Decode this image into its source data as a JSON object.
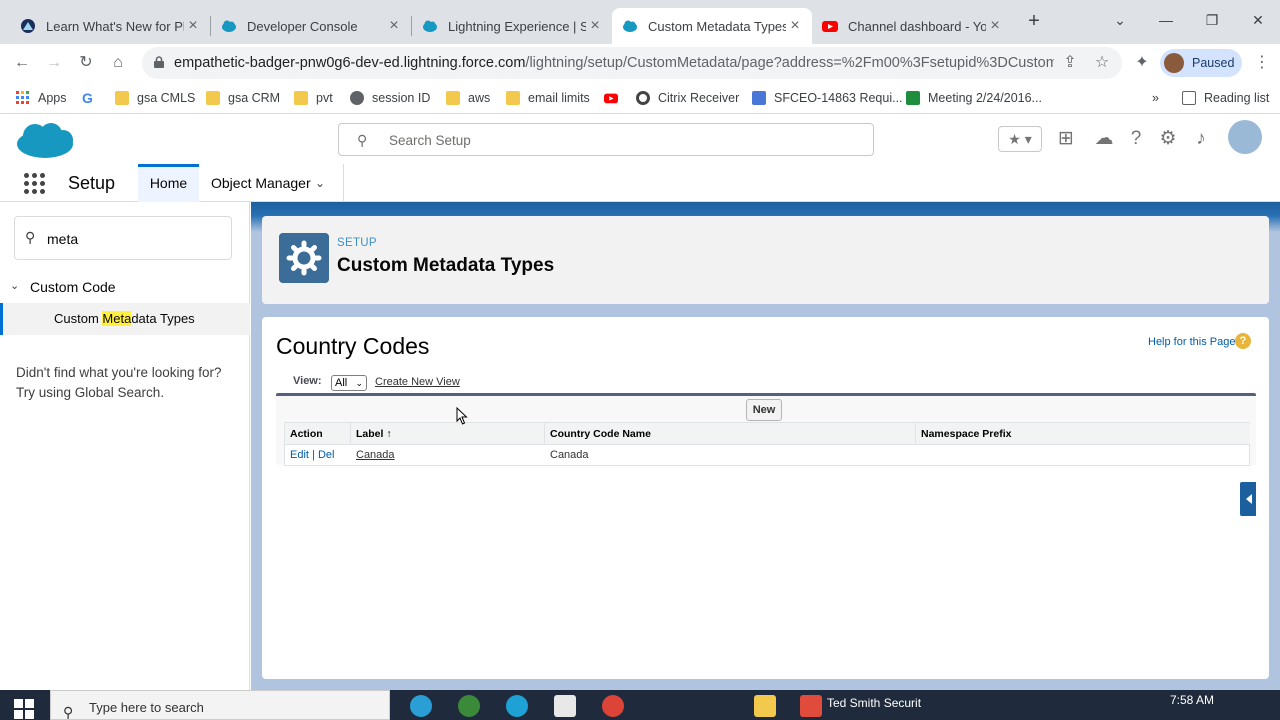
{
  "browser": {
    "tabs": [
      {
        "title": "Learn What's New for Platf",
        "icon": "trailhead-icon",
        "color": "#1b2f5b"
      },
      {
        "title": "Developer Console",
        "icon": "salesforce-cloud-icon",
        "color": "#1798c1"
      },
      {
        "title": "Lightning Experience | Sal",
        "icon": "salesforce-cloud-icon",
        "color": "#1798c1"
      },
      {
        "title": "Custom Metadata Types |",
        "icon": "salesforce-cloud-icon",
        "color": "#1798c1"
      },
      {
        "title": "Channel dashboard - You",
        "icon": "youtube-icon",
        "color": "#ff0000"
      }
    ],
    "active_tab_index": 3,
    "url_domain": "empathetic-badger-pnw0g6-dev-ed.lightning.force.com",
    "url_path": "/lightning/setup/CustomMetadata/page?address=%2Fm00%3Fsetupid%3DCustom...",
    "profile_label": "Paused",
    "bookmarks": [
      {
        "label": "Apps",
        "icon": "apps-grid-icon"
      },
      {
        "label": "",
        "icon": "google-icon"
      },
      {
        "label": "gsa CMLS",
        "icon": "folder-icon"
      },
      {
        "label": "gsa CRM",
        "icon": "folder-icon"
      },
      {
        "label": "pvt",
        "icon": "folder-icon"
      },
      {
        "label": "session ID",
        "icon": "globe-icon"
      },
      {
        "label": "aws",
        "icon": "folder-icon"
      },
      {
        "label": "email limits",
        "icon": "folder-icon"
      },
      {
        "label": "",
        "icon": "youtube-icon"
      },
      {
        "label": "Citrix Receiver",
        "icon": "citrix-icon"
      },
      {
        "label": "SFCEO-14863 Requi...",
        "icon": "doc-icon"
      },
      {
        "label": "Meeting 2/24/2016...",
        "icon": "sheets-icon"
      }
    ],
    "bookmarks_overflow": "»",
    "reading_list": "Reading list"
  },
  "sf": {
    "search_placeholder": "Search Setup",
    "app_name": "Setup",
    "nav_tabs": {
      "home": "Home",
      "object_manager": "Object Manager"
    },
    "sidebar": {
      "quick_find_value": "meta",
      "section": "Custom Code",
      "item_pre": "Custom ",
      "item_match": "Meta",
      "item_post": "data Types",
      "not_found_1": "Didn't find what you're looking for?",
      "not_found_2": "Try using Global Search."
    },
    "page_header": {
      "eyebrow": "SETUP",
      "title": "Custom Metadata Types"
    },
    "list": {
      "title": "Country Codes",
      "help": "Help for this Page",
      "help_glyph": "?",
      "view_label": "View:",
      "view_value": "All",
      "create_view": "Create New View",
      "new_button": "New",
      "columns": [
        "Action",
        "Label ↑",
        "Country Code Name",
        "Namespace Prefix"
      ],
      "rows": [
        {
          "edit": "Edit",
          "sep": "|",
          "del": "Del",
          "label": "Canada",
          "country_code_name": "Canada",
          "namespace_prefix": ""
        }
      ]
    }
  },
  "taskbar": {
    "search_text": "Type here to search",
    "time": "7:58 AM",
    "running_app": "Ted Smith Securit"
  },
  "colors": {
    "brand_blue": "#0070d2",
    "sf_cloud": "#1798c1",
    "link": "#015ba7"
  }
}
